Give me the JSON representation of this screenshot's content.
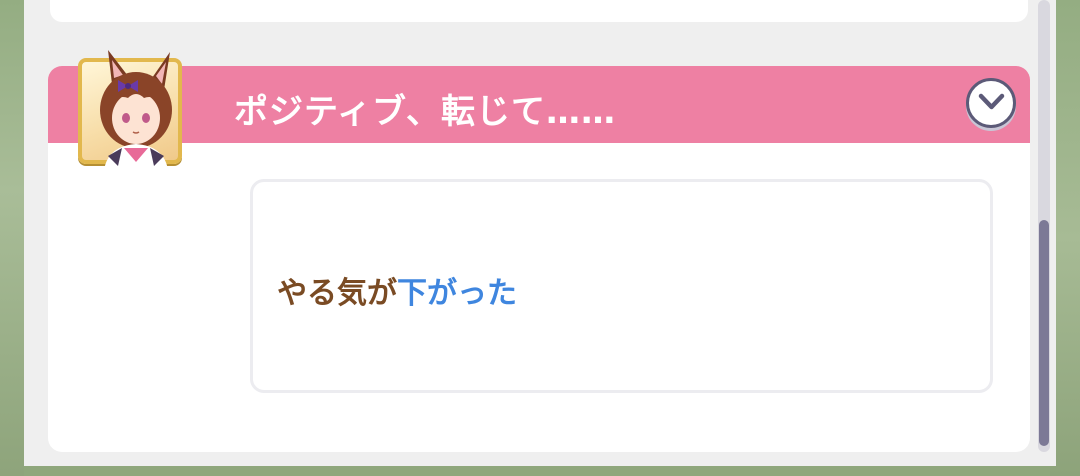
{
  "event": {
    "title": "ポジティブ、転じて……",
    "result_main": "やる気が",
    "result_accent": "下がった"
  },
  "icons": {
    "toggle": "chevron-down-icon",
    "avatar": "character-portrait"
  },
  "colors": {
    "header": "#ee80a3",
    "result_text": "#7a4b24",
    "result_accent": "#3f86df",
    "avatar_frame": "#e2b84d"
  }
}
